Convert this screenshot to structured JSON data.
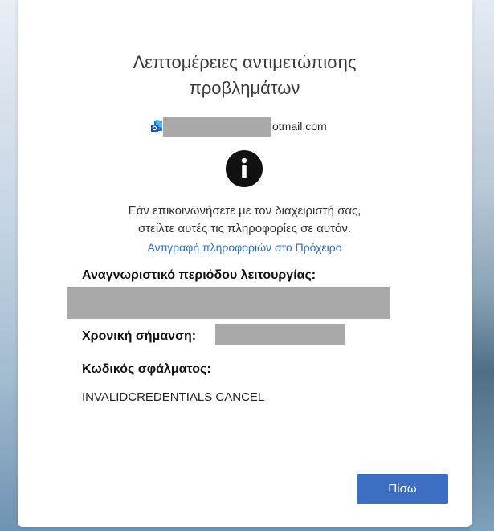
{
  "dialog": {
    "title_line1": "Λεπτομέρειες αντιμετώπισης",
    "title_line2": "προβλημάτων",
    "account_suffix": "otmail.com",
    "info_icon_glyph": "i",
    "message_line1": "Εάν επικοινωνήσετε με τον διαχειριστή σας,",
    "message_line2": "στείλτε αυτές τις πληροφορίες σε αυτόν.",
    "copy_link": "Αντιγραφή πληροφοριών στο Πρόχειρο",
    "session_id_label": "Αναγνωριστικό περιόδου λειτουργίας:",
    "timestamp_label": "Χρονική σήμανση:",
    "error_code_label": "Κωδικός σφάλματος:",
    "error_code_value": "INVALIDCREDENTIALS CANCEL",
    "back_button": "Πίσω"
  },
  "icons": {
    "app": "outlook-app-icon",
    "info": "info-icon"
  },
  "colors": {
    "accent": "#3c6fc1",
    "link": "#2f6fb5",
    "redaction": "#a9a9a9"
  }
}
